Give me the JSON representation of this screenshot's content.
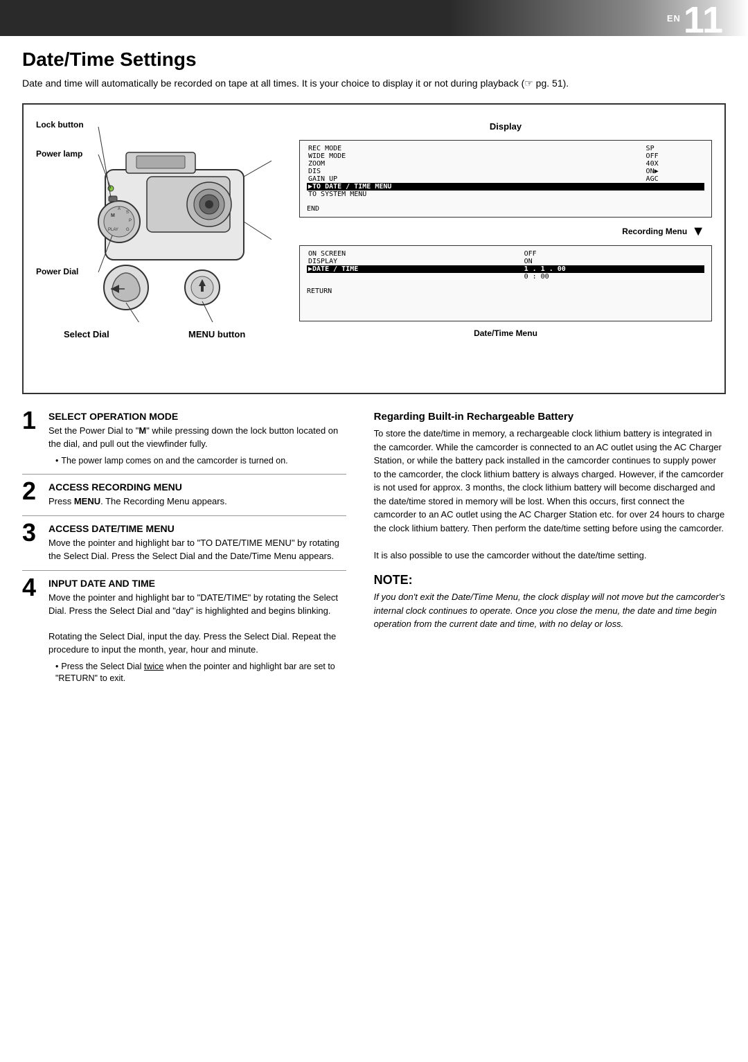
{
  "header": {
    "en_label": "EN",
    "page_number": "11"
  },
  "page": {
    "title": "Date/Time Settings",
    "intro": "Date and time will automatically be recorded on tape at all times. It is your choice to display it or not during playback (☞ pg. 51)."
  },
  "diagram": {
    "labels": {
      "lock_button": "Lock button",
      "power_lamp": "Power lamp",
      "power_dial": "Power Dial",
      "select_dial": "Select Dial",
      "menu_button": "MENU button",
      "display": "Display"
    },
    "recording_menu": {
      "title": "Recording Menu",
      "rows": [
        {
          "label": "REC MODE",
          "value": "SP"
        },
        {
          "label": "WIDE MODE",
          "value": "OFF"
        },
        {
          "label": "ZOOM",
          "value": "40X"
        },
        {
          "label": "DIS",
          "value": "ON▶"
        },
        {
          "label": "GAIN UP",
          "value": "AGC"
        },
        {
          "label": "▶TO DATE / TIME MENU",
          "value": "",
          "highlight": true
        },
        {
          "label": "TO SYSTEM MENU",
          "value": ""
        }
      ],
      "end_label": "END"
    },
    "datetime_menu": {
      "title": "Date/Time Menu",
      "rows": [
        {
          "label": "ON SCREEN",
          "value": "OFF"
        },
        {
          "label": "DISPLAY",
          "value": "ON"
        },
        {
          "label": "▶DATE / TIME",
          "value": "1 . 1 . 00",
          "highlight": true
        },
        {
          "label": "",
          "value": "0 : 00"
        }
      ],
      "return_label": "RETURN"
    }
  },
  "steps": [
    {
      "number": "1",
      "title": "SELECT OPERATION MODE",
      "body": "Set the Power Dial to \"M\" while pressing down the lock button located on the dial, and pull out the viewfinder fully.",
      "bullet": "The power lamp comes on and the camcorder is turned on."
    },
    {
      "number": "2",
      "title": "ACCESS RECORDING MENU",
      "body": "Press MENU. The Recording Menu appears.",
      "bullet": null
    },
    {
      "number": "3",
      "title": "ACCESS DATE/TIME MENU",
      "body": "Move the pointer and highlight bar to \"TO DATE/TIME MENU\" by rotating the Select Dial. Press the Select Dial and the Date/Time Menu appears.",
      "bullet": null
    },
    {
      "number": "4",
      "title": "INPUT DATE AND TIME",
      "body": "Move the pointer and highlight bar to \"DATE/TIME\" by rotating the Select Dial. Press the Select Dial and \"day\" is highlighted and begins blinking.\n\nRotating the Select Dial, input the day. Press the Select Dial. Repeat the procedure to input the month, year, hour and minute.",
      "bullet": "Press the Select Dial twice when the pointer and highlight bar are set to \"RETURN\" to exit.",
      "bullet_underline": "twice"
    }
  ],
  "right_column": {
    "battery_section": {
      "title": "Regarding Built-in Rechargeable Battery",
      "body": "To store the date/time in memory, a rechargeable clock lithium battery is integrated in the camcorder. While the camcorder is connected to an AC outlet using the AC Charger Station, or while the battery pack installed in the camcorder continues to supply power to the camcorder, the clock lithium battery is always charged. However, if the camcorder is not used for approx. 3 months, the clock lithium battery will become discharged and the date/time stored in memory will be lost. When this occurs, first connect the camcorder to an AC outlet using the AC Charger Station etc. for over 24 hours to charge the clock lithium battery. Then perform the date/time setting before using the camcorder.\n\nIt is also possible to use the camcorder without the date/time setting."
    },
    "note_section": {
      "title": "NOTE:",
      "body": "If you don't exit the Date/Time Menu, the clock display will not move but the camcorder's internal clock continues to operate. Once you close the menu, the date and time begin operation from the current date and time, with no delay or loss."
    }
  }
}
